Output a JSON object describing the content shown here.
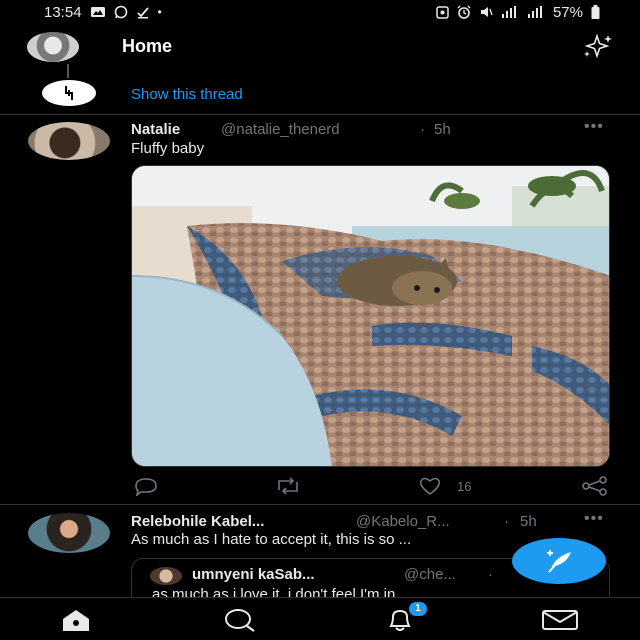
{
  "status_bar": {
    "time": "13:54",
    "battery": "57%"
  },
  "header": {
    "title": "Home"
  },
  "thread": {
    "show_thread_label": "Show this thread"
  },
  "tweets": [
    {
      "name": "Natalie",
      "handle": "@natalie_thenerd",
      "separator": "·",
      "time": "5h",
      "text": "Fluffy baby",
      "likes": "16"
    },
    {
      "name": "Relebohile Kabel...",
      "handle": "@Kabelo_R...",
      "separator": "·",
      "time": "5h",
      "text": "As much as I hate to accept it, this is so ...",
      "quote": {
        "name": "umnyeni kaSab...",
        "handle": "@che...",
        "separator": "·",
        "text": "as much as i love it, i don't feel I'm in"
      }
    }
  ],
  "bottom_nav": {
    "notification_count": "1"
  },
  "colors": {
    "accent": "#1d9bf0",
    "background": "#000000",
    "muted": "#71767b"
  }
}
